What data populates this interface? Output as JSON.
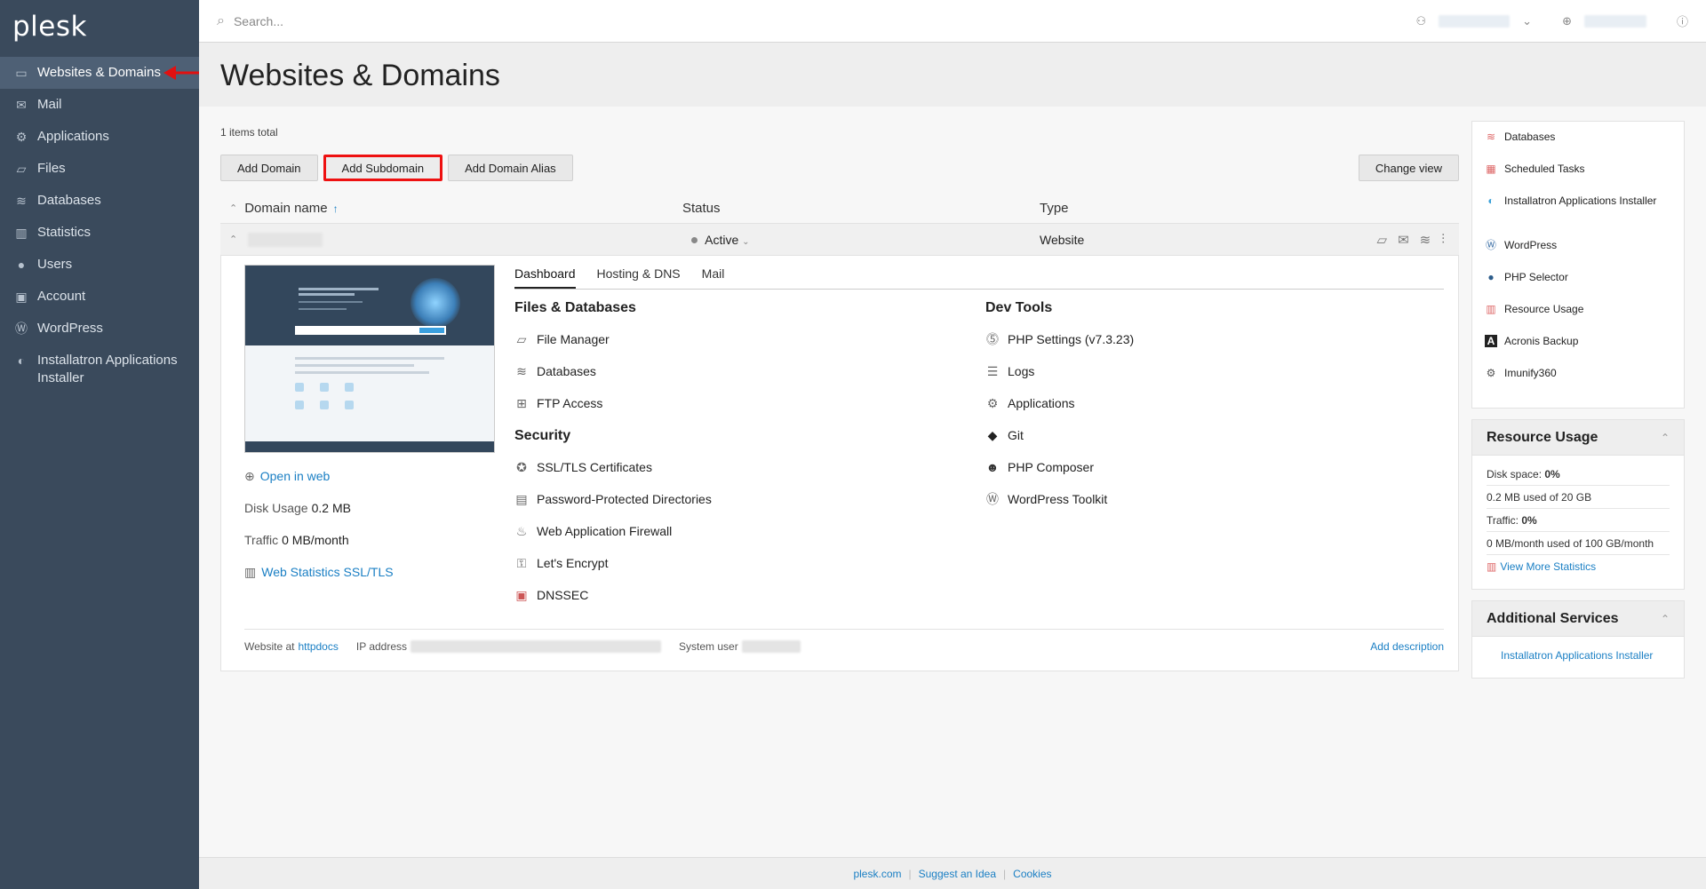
{
  "app": {
    "logo": "plesk"
  },
  "sidebar": {
    "items": [
      {
        "label": "Websites & Domains",
        "icon": "monitor-icon"
      },
      {
        "label": "Mail",
        "icon": "mail-icon"
      },
      {
        "label": "Applications",
        "icon": "gear-icon"
      },
      {
        "label": "Files",
        "icon": "folder-icon"
      },
      {
        "label": "Databases",
        "icon": "stack-icon"
      },
      {
        "label": "Statistics",
        "icon": "bar-chart-icon"
      },
      {
        "label": "Users",
        "icon": "user-icon"
      },
      {
        "label": "Account",
        "icon": "briefcase-icon"
      },
      {
        "label": "WordPress",
        "icon": "wordpress-icon"
      },
      {
        "label": "Installatron Applications Installer",
        "icon": "installatron-icon"
      }
    ]
  },
  "topbar": {
    "search_placeholder": "Search..."
  },
  "page": {
    "title": "Websites & Domains",
    "items_total": "1 items total"
  },
  "toolbar": {
    "add_domain": "Add Domain",
    "add_subdomain": "Add Subdomain",
    "add_alias": "Add Domain Alias",
    "change_view": "Change view"
  },
  "table": {
    "headers": {
      "name": "Domain name",
      "status": "Status",
      "type": "Type"
    },
    "row": {
      "status": "Active",
      "type": "Website"
    }
  },
  "domain_panel": {
    "open_in_web": "Open in web",
    "disk_usage_label": "Disk Usage",
    "disk_usage_value": "0.2 MB",
    "traffic_label": "Traffic",
    "traffic_value": "0 MB/month",
    "web_stats": "Web Statistics SSL/TLS",
    "tabs": [
      "Dashboard",
      "Hosting & DNS",
      "Mail"
    ],
    "files_title": "Files & Databases",
    "files_tools": [
      "File Manager",
      "Databases",
      "FTP Access"
    ],
    "security_title": "Security",
    "security_tools": [
      "SSL/TLS Certificates",
      "Password-Protected Directories",
      "Web Application Firewall",
      "Let's Encrypt",
      "DNSSEC"
    ],
    "dev_title": "Dev Tools",
    "dev_tools": [
      "PHP Settings (v7.3.23)",
      "Logs",
      "Applications",
      "Git",
      "PHP Composer",
      "WordPress Toolkit"
    ],
    "footer": {
      "website_at": "Website at",
      "httpdocs": "httpdocs",
      "ip_label": "IP address",
      "system_user_label": "System user",
      "add_description": "Add description"
    }
  },
  "right": {
    "links": [
      "Databases",
      "Scheduled Tasks",
      "Installatron Applications Installer",
      "WordPress",
      "PHP Selector",
      "Resource Usage",
      "Acronis Backup",
      "Imunify360"
    ],
    "resource": {
      "title": "Resource Usage",
      "disk_label": "Disk space:",
      "disk_pct": "0%",
      "disk_detail": "0.2 MB used of 20 GB",
      "traffic_label": "Traffic:",
      "traffic_pct": "0%",
      "traffic_detail": "0 MB/month used of 100 GB/month",
      "more": "View More Statistics"
    },
    "additional": {
      "title": "Additional Services",
      "item": "Installatron Applications Installer"
    }
  },
  "footer": {
    "links": [
      "plesk.com",
      "Suggest an Idea",
      "Cookies"
    ]
  },
  "colors": {
    "sidebar": "#3a4a5c",
    "sidebar_active": "#4e6075",
    "link": "#1a7fc4",
    "annotation": "#e11111"
  }
}
